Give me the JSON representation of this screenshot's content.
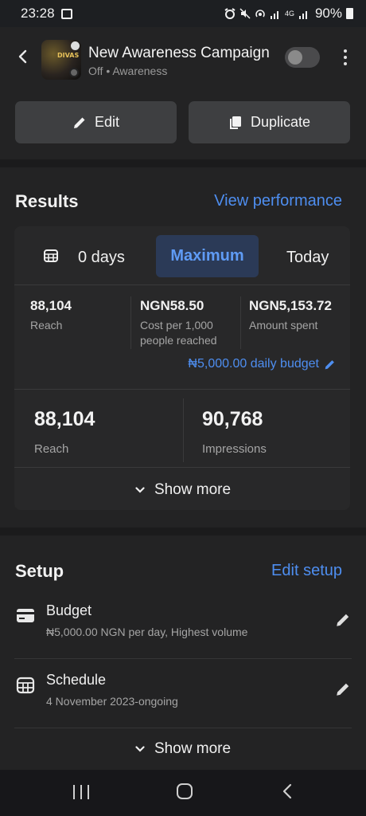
{
  "status_bar": {
    "time": "23:28",
    "network": "4G",
    "battery": "90%"
  },
  "campaign": {
    "name": "New Awareness Campaign",
    "status": "Off",
    "separator": "•",
    "objective": "Awareness",
    "thumbnail_text": "DIVAS",
    "enabled": false
  },
  "actions": {
    "edit": "Edit",
    "duplicate": "Duplicate"
  },
  "results": {
    "title": "Results",
    "link": "View performance",
    "date_options": [
      {
        "label": "0 days",
        "icon": "calendar-icon",
        "selected": false
      },
      {
        "label": "Maximum",
        "selected": true
      },
      {
        "label": "Today",
        "selected": false
      }
    ],
    "metrics": [
      {
        "value": "88,104",
        "label": "Reach"
      },
      {
        "value": "NGN58.50",
        "label": "Cost per 1,000 people reached"
      },
      {
        "value": "NGN5,153.72",
        "label": "Amount spent"
      }
    ],
    "budget_link": "₦5,000.00 daily budget",
    "big_metrics": [
      {
        "value": "88,104",
        "label": "Reach"
      },
      {
        "value": "90,768",
        "label": "Impressions"
      }
    ],
    "show_more": "Show more"
  },
  "setup": {
    "title": "Setup",
    "link": "Edit setup",
    "items": [
      {
        "icon": "card-icon",
        "title": "Budget",
        "detail": "₦5,000.00 NGN per day, Highest volume"
      },
      {
        "icon": "calendar-icon",
        "title": "Schedule",
        "detail": "4 November 2023-ongoing"
      }
    ],
    "show_more": "Show more"
  },
  "colors": {
    "accent": "#4e8ef0",
    "background": "#1b1b1c",
    "surface": "#232324",
    "selected_bg": "#2b3a57"
  }
}
